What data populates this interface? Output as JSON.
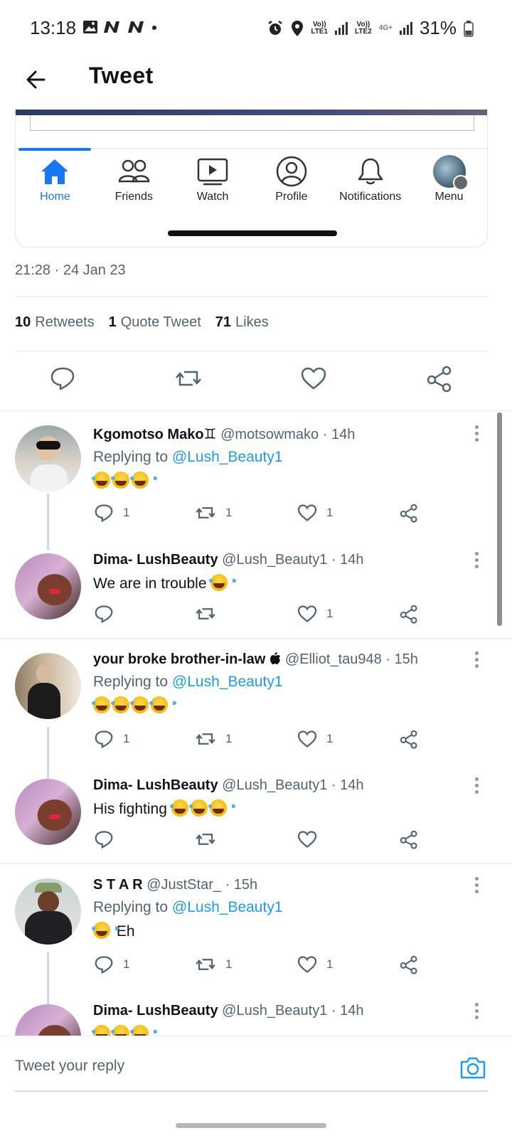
{
  "status_bar": {
    "time": "13:18",
    "battery": "31%",
    "sim1": "LTE1",
    "sim2": "LTE2",
    "net": "4G+"
  },
  "header": {
    "title": "Tweet"
  },
  "embedded_nav": {
    "items": [
      {
        "label": "Home",
        "icon": "home-icon",
        "active": true
      },
      {
        "label": "Friends",
        "icon": "friends-icon"
      },
      {
        "label": "Watch",
        "icon": "watch-icon"
      },
      {
        "label": "Profile",
        "icon": "profile-icon"
      },
      {
        "label": "Notifications",
        "icon": "bell-icon"
      },
      {
        "label": "Menu",
        "icon": "menu-avatar-icon"
      }
    ]
  },
  "tweet": {
    "timestamp": "21:28 · 24 Jan 23",
    "retweets_count": "10",
    "retweets_label": "Retweets",
    "quotes_count": "1",
    "quotes_label": "Quote Tweet",
    "likes_count": "71",
    "likes_label": "Likes"
  },
  "replies": [
    {
      "name": "Kgomotso Mako♊",
      "handle": "@motsowmako",
      "time": "· 14h",
      "replying_label": "Replying to",
      "replying_to": "@Lush_Beauty1",
      "text": "",
      "emoji_count": 3,
      "comments": "1",
      "retweets": "1",
      "likes": "1"
    },
    {
      "name": "Dima- LushBeauty",
      "handle": "@Lush_Beauty1",
      "time": "· 14h",
      "text": "We are in trouble",
      "emoji_count": 1,
      "comments": "",
      "retweets": "",
      "likes": "1"
    },
    {
      "name": "your broke brother-in-law ",
      "handle": "@Elliot_tau948",
      "time": "· 15h",
      "replying_label": "Replying to",
      "replying_to": "@Lush_Beauty1",
      "text": "",
      "emoji_count": 4,
      "comments": "1",
      "retweets": "1",
      "likes": "1"
    },
    {
      "name": "Dima- LushBeauty",
      "handle": "@Lush_Beauty1",
      "time": "· 14h",
      "text": "His fighting",
      "emoji_count": 3,
      "comments": "",
      "retweets": "",
      "likes": ""
    },
    {
      "name": "S T A R",
      "handle": "@JustStar_",
      "time": "· 15h",
      "replying_label": "Replying to",
      "replying_to": "@Lush_Beauty1",
      "text": "Eh",
      "emoji_count": 1,
      "comments": "1",
      "retweets": "1",
      "likes": "1"
    },
    {
      "name": "Dima- LushBeauty",
      "handle": "@Lush_Beauty1",
      "time": "· 14h",
      "text": "",
      "emoji_count": 3
    }
  ],
  "composer": {
    "placeholder": "Tweet your reply"
  },
  "colors": {
    "accent": "#1d9bf0",
    "fb_blue": "#1877f2",
    "muted": "#536471"
  }
}
